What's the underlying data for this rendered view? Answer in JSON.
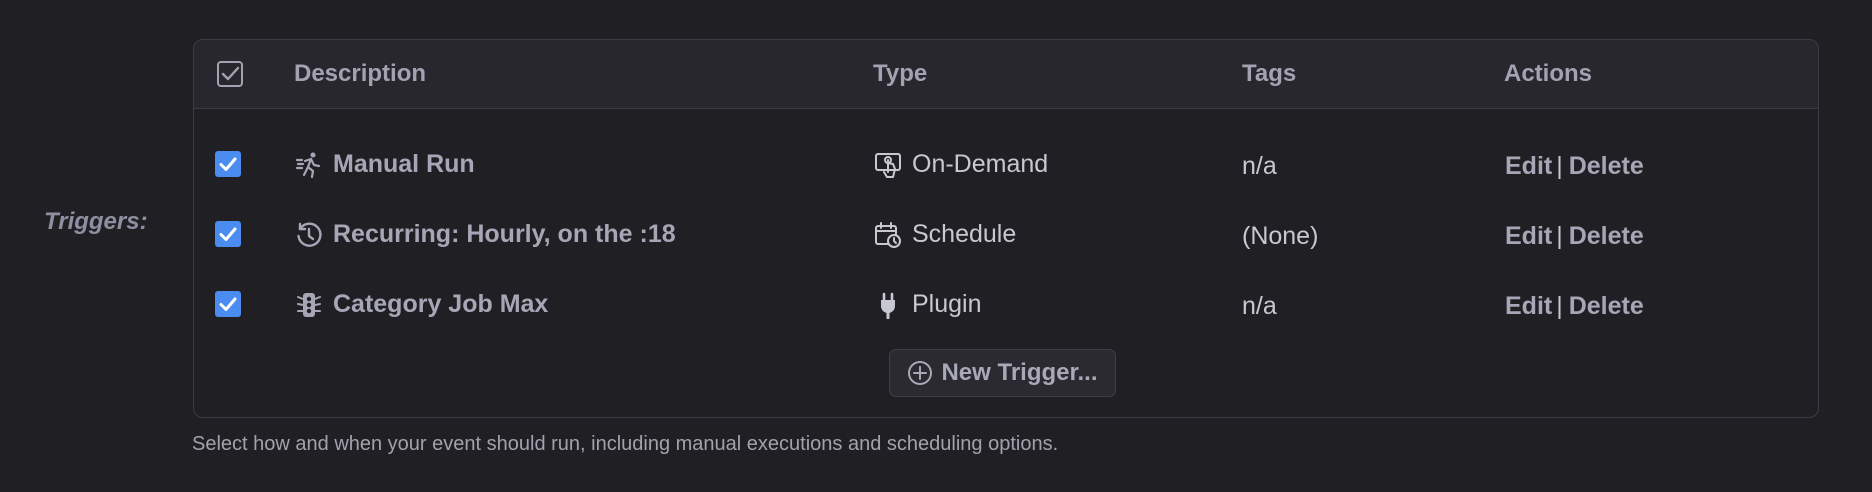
{
  "field_label": "Triggers:",
  "table": {
    "headers": {
      "select_all": "checkbox-outline-icon",
      "description": "Description",
      "type": "Type",
      "tags": "Tags",
      "actions": "Actions"
    },
    "rows": [
      {
        "checked": true,
        "icon": "running-person-icon",
        "description": "Manual Run",
        "type_icon": "touch-screen-icon",
        "type": "On-Demand",
        "tags": "n/a",
        "edit": "Edit",
        "sep": "|",
        "delete": "Delete"
      },
      {
        "checked": true,
        "icon": "clock-history-icon",
        "description": "Recurring: Hourly, on the :18",
        "type_icon": "calendar-clock-icon",
        "type": "Schedule",
        "tags": "(None)",
        "edit": "Edit",
        "sep": "|",
        "delete": "Delete"
      },
      {
        "checked": true,
        "icon": "traffic-light-icon",
        "description": "Category Job Max",
        "type_icon": "plug-icon",
        "type": "Plugin",
        "tags": "n/a",
        "edit": "Edit",
        "sep": "|",
        "delete": "Delete"
      }
    ]
  },
  "new_trigger_label": "New Trigger...",
  "help_text": "Select how and when your event should run, including manual executions and scheduling options.",
  "colors": {
    "background": "#202024",
    "checkbox": "#4a8cf0",
    "muted_text": "#a6a6b6"
  }
}
